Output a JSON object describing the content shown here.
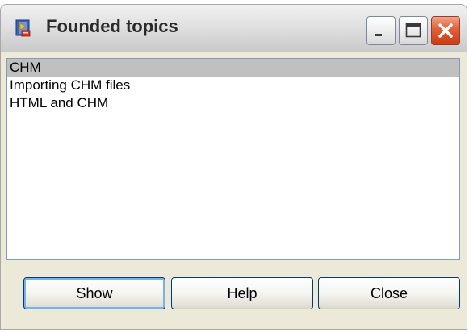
{
  "window": {
    "title": "Founded topics",
    "icon": "help-book-icon",
    "controls": {
      "minimize_icon": "minimize-icon",
      "maximize_icon": "maximize-icon",
      "close_icon": "close-icon"
    }
  },
  "topics": {
    "items": [
      {
        "label": "CHM",
        "selected": true
      },
      {
        "label": "Importing CHM files",
        "selected": false
      },
      {
        "label": "HTML and CHM",
        "selected": false
      }
    ]
  },
  "buttons": {
    "show_label": "Show",
    "help_label": "Help",
    "close_label": "Close"
  },
  "colors": {
    "selection": "#c0c0c0",
    "list_border": "#7f9db9",
    "dialog_face": "#ece9d8",
    "close_button": "#e0643f",
    "default_button_focus": "#7bb1ea"
  }
}
